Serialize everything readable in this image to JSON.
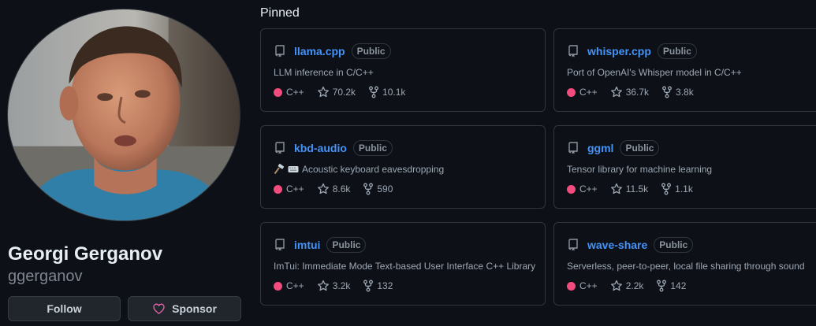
{
  "profile": {
    "full_name": "Georgi Gerganov",
    "username": "ggerganov",
    "follow_label": "Follow",
    "sponsor_label": "Sponsor"
  },
  "pinned": {
    "title": "Pinned",
    "repos": [
      {
        "name": "llama.cpp",
        "visibility": "Public",
        "description": "LLM inference in C/C++",
        "language": "C++",
        "language_color": "#f34b7d",
        "stars": "70.2k",
        "forks": "10.1k"
      },
      {
        "name": "whisper.cpp",
        "visibility": "Public",
        "description": "Port of OpenAI's Whisper model in C/C++",
        "language": "C++",
        "language_color": "#f34b7d",
        "stars": "36.7k",
        "forks": "3.8k"
      },
      {
        "name": "kbd-audio",
        "visibility": "Public",
        "description": "Acoustic keyboard eavesdropping",
        "description_icons": [
          "hammer-icon",
          "keyboard-icon"
        ],
        "language": "C++",
        "language_color": "#f34b7d",
        "stars": "8.6k",
        "forks": "590"
      },
      {
        "name": "ggml",
        "visibility": "Public",
        "description": "Tensor library for machine learning",
        "language": "C++",
        "language_color": "#f34b7d",
        "stars": "11.5k",
        "forks": "1.1k"
      },
      {
        "name": "imtui",
        "visibility": "Public",
        "description": "ImTui: Immediate Mode Text-based User Interface C++ Library",
        "language": "C++",
        "language_color": "#f34b7d",
        "stars": "3.2k",
        "forks": "132"
      },
      {
        "name": "wave-share",
        "visibility": "Public",
        "description": "Serverless, peer-to-peer, local file sharing through sound",
        "language": "C++",
        "language_color": "#f34b7d",
        "stars": "2.2k",
        "forks": "142"
      }
    ]
  },
  "colors": {
    "background": "#0d1117",
    "link": "#4493f8",
    "border": "#30363d",
    "sponsor_heart": "#db61a2"
  }
}
